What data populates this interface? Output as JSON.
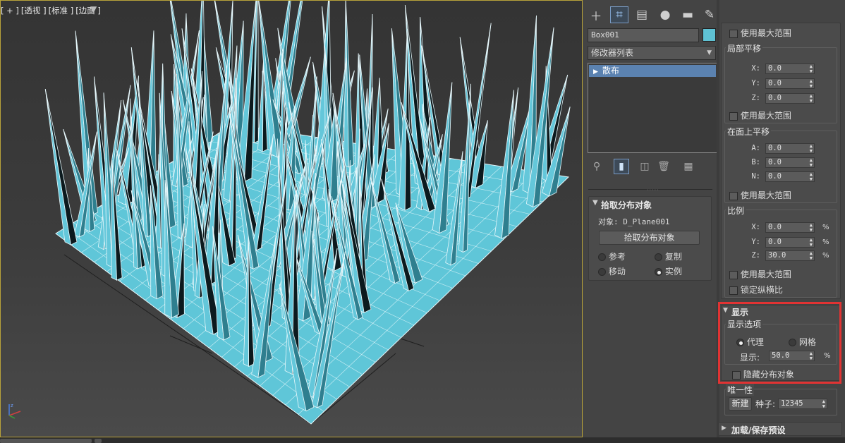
{
  "viewport": {
    "labels": [
      "[ + ]",
      "[透视 ]",
      "[标准 ]",
      "[边面 ]"
    ],
    "filter_icon": "funnel-icon",
    "scene_color": "#60c4d8"
  },
  "command_panel": {
    "tabs": [
      {
        "name": "create",
        "icon": "plus-icon"
      },
      {
        "name": "modify",
        "icon": "modify-icon"
      },
      {
        "name": "hierarchy",
        "icon": "hierarchy-icon"
      },
      {
        "name": "motion",
        "icon": "motion-icon"
      },
      {
        "name": "display",
        "icon": "display-icon"
      },
      {
        "name": "utilities",
        "icon": "wrench-icon"
      }
    ],
    "object_name": "Box001",
    "object_color": "#5fc2d4",
    "modifier_list_label": "修改器列表",
    "stack_item": "散布",
    "pick_rollout": {
      "title": "拾取分布对象",
      "object_label": "对象: D_Plane001",
      "pick_button": "拾取分布对象",
      "options": [
        "参考",
        "复制",
        "移动",
        "实例"
      ],
      "selected": "实例"
    },
    "right": {
      "use_max_range_top": "使用最大范围",
      "local_translation": {
        "title": "局部平移",
        "x_label": "X:",
        "x": "0.0",
        "y_label": "Y:",
        "y": "0.0",
        "z_label": "Z:",
        "z": "0.0",
        "use_max_range": "使用最大范围"
      },
      "on_face_translation": {
        "title": "在面上平移",
        "a_label": "A:",
        "a": "0.0",
        "b_label": "B:",
        "b": "0.0",
        "n_label": "N:",
        "n": "0.0",
        "use_max_range": "使用最大范围"
      },
      "scale": {
        "title": "比例",
        "x_label": "X:",
        "x": "0.0",
        "y_label": "Y:",
        "y": "0.0",
        "z_label": "Z:",
        "z": "30.0",
        "pct": "%",
        "use_max_range": "使用最大范围",
        "lock_aspect": "锁定纵横比"
      },
      "display": {
        "title": "显示",
        "options_title": "显示选项",
        "proxy": "代理",
        "mesh": "网格",
        "selected": "代理",
        "display_label": "显示:",
        "display_value": "50.0",
        "pct": "%",
        "hide_distribution": "隐藏分布对象"
      },
      "uniqueness": {
        "title": "唯一性",
        "new_button": "新建",
        "seed_label": "种子:",
        "seed": "12345"
      },
      "load_save": "加载/保存预设"
    }
  }
}
